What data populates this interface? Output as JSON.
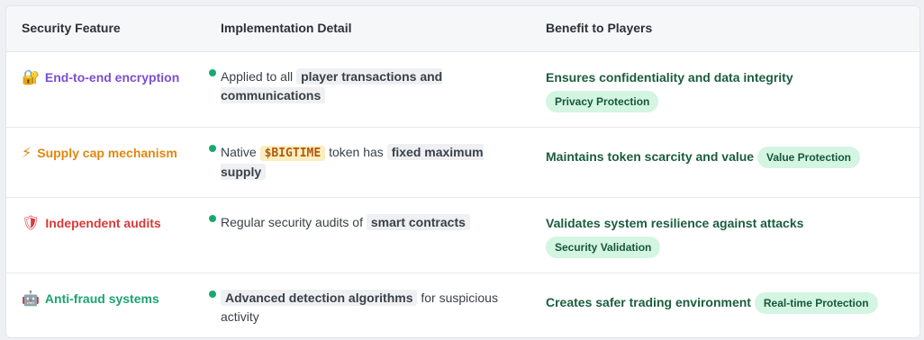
{
  "header": {
    "col1": "Security Feature",
    "col2": "Implementation Detail",
    "col3": "Benefit to Players"
  },
  "colors": {
    "purple": "#7b4fd1",
    "orange": "#e0870e",
    "red": "#d83a3a",
    "green": "#1aa56e",
    "badge_bg": "#d3f5e2",
    "dot": "#19a96f"
  },
  "rows": [
    {
      "icon": "lock-with-key-icon",
      "emoji": "🔐",
      "feature": "End-to-end encryption",
      "impl_pre": "Applied to all ",
      "impl_code": "player transactions and communications",
      "impl_post": "",
      "benefit": "Ensures confidentiality and data integrity",
      "badge": "Privacy Protection"
    },
    {
      "icon": "lightning-icon",
      "emoji": "⚡",
      "feature": "Supply cap mechanism",
      "impl_pre": "Native ",
      "impl_token": "$BIGTIME",
      "impl_mid": " token has ",
      "impl_code": "fixed maximum supply",
      "benefit": "Maintains token scarcity and value",
      "badge": "Value Protection"
    },
    {
      "icon": "shield-icon",
      "emoji": "🛡",
      "feature": "Independent audits",
      "impl_pre": "Regular security audits of ",
      "impl_code": "smart contracts",
      "impl_post": "",
      "benefit": "Validates system resilience against attacks",
      "badge": "Security Validation"
    },
    {
      "icon": "robot-icon",
      "emoji": "🤖",
      "feature": "Anti-fraud systems",
      "impl_code": "Advanced detection algorithms",
      "impl_post": " for suspicious activity",
      "benefit": "Creates safer trading environment",
      "badge": "Real-time Protection"
    }
  ]
}
